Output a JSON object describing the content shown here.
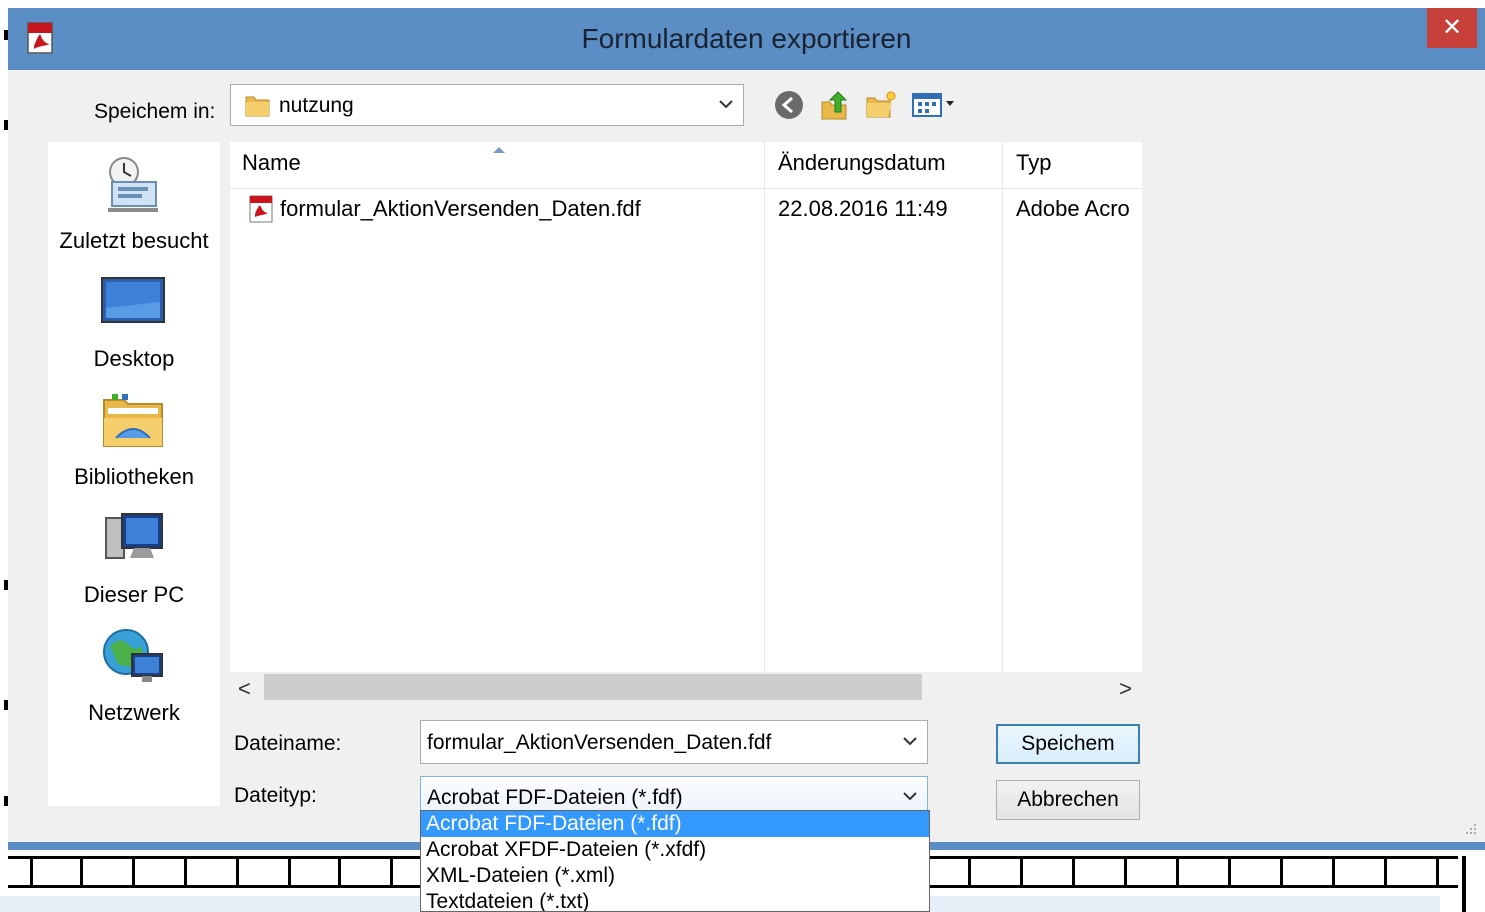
{
  "dialog": {
    "title": "Formulardaten exportieren",
    "close_label": "✕"
  },
  "savein": {
    "label": "Speichem in:",
    "value": "nutzung"
  },
  "places": [
    {
      "label": "Zuletzt besucht",
      "icon": "recent-places-icon"
    },
    {
      "label": "Desktop",
      "icon": "desktop-icon"
    },
    {
      "label": "Bibliotheken",
      "icon": "libraries-icon"
    },
    {
      "label": "Dieser PC",
      "icon": "computer-icon"
    },
    {
      "label": "Netzwerk",
      "icon": "network-icon"
    }
  ],
  "filelist": {
    "columns": [
      "Name",
      "Änderungsdatum",
      "Typ"
    ],
    "rows": [
      {
        "name": "formular_AktionVersenden_Daten.fdf",
        "modified": "22.08.2016 11:49",
        "type": "Adobe Acro"
      }
    ]
  },
  "scroll": {
    "left": "<",
    "right": ">"
  },
  "filename": {
    "label": "Dateiname:",
    "value": "formular_AktionVersenden_Daten.fdf"
  },
  "filetype": {
    "label": "Dateityp:",
    "value": "Acrobat FDF-Dateien (*.fdf)",
    "options": [
      "Acrobat FDF-Dateien (*.fdf)",
      "Acrobat XFDF-Dateien (*.xfdf)",
      "XML-Dateien (*.xml)",
      "Textdateien (*.txt)"
    ],
    "selected_index": 0
  },
  "buttons": {
    "save": "Speichem",
    "cancel": "Abbrechen"
  },
  "colors": {
    "titlebar": "#5b8ec4",
    "close": "#c7403a",
    "selection": "#3399ff"
  }
}
